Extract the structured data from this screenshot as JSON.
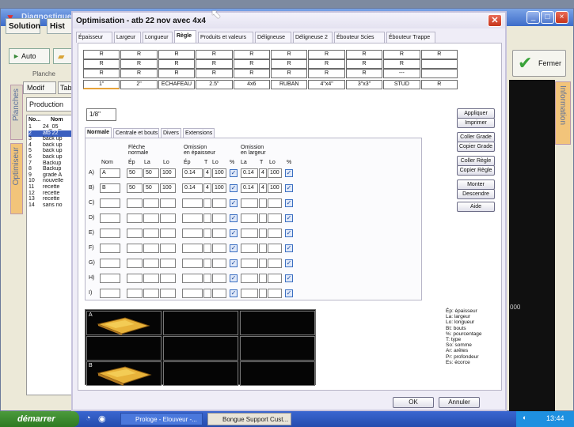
{
  "bg_window": {
    "title": "Diagnostique",
    "tabs": [
      "Solution",
      "Hist"
    ],
    "auto_label": "Auto",
    "planche_label": "Planche",
    "modif_label": "Modif",
    "tab_short": "Tab",
    "production_label": "Production",
    "left_vtabs": [
      "Planches",
      "Optimiseur"
    ],
    "right_vtab": "Information",
    "fermer_label": "Fermer",
    "right_number": "000",
    "list_headers": [
      "No...",
      "Nom"
    ],
    "list_rows": [
      [
        "1",
        "24_05_"
      ],
      [
        "2",
        "atb 22"
      ],
      [
        "3",
        "back up"
      ],
      [
        "4",
        "back up"
      ],
      [
        "5",
        "back up"
      ],
      [
        "6",
        "back up"
      ],
      [
        "7",
        "Backup"
      ],
      [
        "8",
        "Backup"
      ],
      [
        "9",
        "grade A"
      ],
      [
        "10",
        "nouvelle"
      ],
      [
        "11",
        "recette"
      ],
      [
        "12",
        "recette"
      ],
      [
        "13",
        "recette"
      ],
      [
        "14",
        "sans no"
      ]
    ]
  },
  "taskbar": {
    "start_label": "démarrer",
    "tasks": [
      "Prologe - Elouveur -...",
      "Bongue Support Cust..."
    ],
    "time": "13:44"
  },
  "dialog": {
    "title": "Optimisation - atb 22 nov avec 4x4",
    "tabs": [
      "Épaisseur",
      "Largeur",
      "Longueur",
      "Règle",
      "Produits et valeurs",
      "Déligneuse",
      "Déligneuse 2",
      "Ébouteur Scies",
      "Ébouteur Trappe"
    ],
    "active_tab": "Règle",
    "r_rows": [
      [
        "R",
        "R",
        "R",
        "R",
        "R",
        "R",
        "R",
        "R",
        "R",
        "R"
      ],
      [
        "R",
        "R",
        "R",
        "R",
        "R",
        "R",
        "R",
        "R",
        "R",
        ""
      ],
      [
        "R",
        "R",
        "R",
        "R",
        "R",
        "R",
        "R",
        "R",
        "---",
        ""
      ]
    ],
    "header_row": [
      "1\"",
      "2\"",
      "ECHAFEAU",
      "2.5\"",
      "4x6",
      "RUBAN",
      "4\"x4\"",
      "3\"x3\"",
      "STUD",
      "R"
    ],
    "small_input_value": "1/8\"",
    "inner_tabs": [
      "Normale",
      "Centrale et bouts",
      "Divers",
      "Extensions"
    ],
    "table": {
      "group_fleche": [
        "Flèche",
        "normale"
      ],
      "group_omission_ep": [
        "Omission",
        "en épaisseur"
      ],
      "group_omission_la": [
        "Omission",
        "en largeur"
      ],
      "col_nom": "Nom",
      "cols_fleche": [
        "Ép",
        "La",
        "Lo"
      ],
      "cols_om_ep": [
        "Ép",
        "T",
        "Lo",
        "%"
      ],
      "cols_om_la": [
        "La",
        "T",
        "Lo",
        "%"
      ],
      "rows": [
        {
          "label": "A)",
          "nom": "A",
          "ep": "50",
          "la": "50",
          "lo": "100",
          "oep": "0.14",
          "ot": "4",
          "olo": "100",
          "lla": "0.14",
          "lt": "4",
          "llo": "100"
        },
        {
          "label": "B)",
          "nom": "B",
          "ep": "50",
          "la": "50",
          "lo": "100",
          "oep": "0.14",
          "ot": "4",
          "olo": "100",
          "lla": "0.14",
          "lt": "4",
          "llo": "100"
        },
        {
          "label": "C)"
        },
        {
          "label": "D)"
        },
        {
          "label": "E)"
        },
        {
          "label": "F)"
        },
        {
          "label": "G)"
        },
        {
          "label": "H)"
        },
        {
          "label": "I)"
        }
      ]
    },
    "side_buttons": [
      "Appliquer",
      "Imprimer",
      "Coller Grade",
      "Copier Grade",
      "Coller Règle",
      "Copier Règle",
      "Monter",
      "Descendre",
      "Aide"
    ],
    "preview_labels": [
      "A",
      "B"
    ],
    "legend": [
      "Ép: épaisseur",
      "La: largeur",
      "Lo: longueur",
      "Bt: bouts",
      "%: pourcentage",
      "T: type",
      "So: somme",
      "Ar: arêtes",
      "Pr: profondeur",
      "Es: écorce"
    ],
    "ok_label": "OK",
    "cancel_label": "Annuler"
  }
}
